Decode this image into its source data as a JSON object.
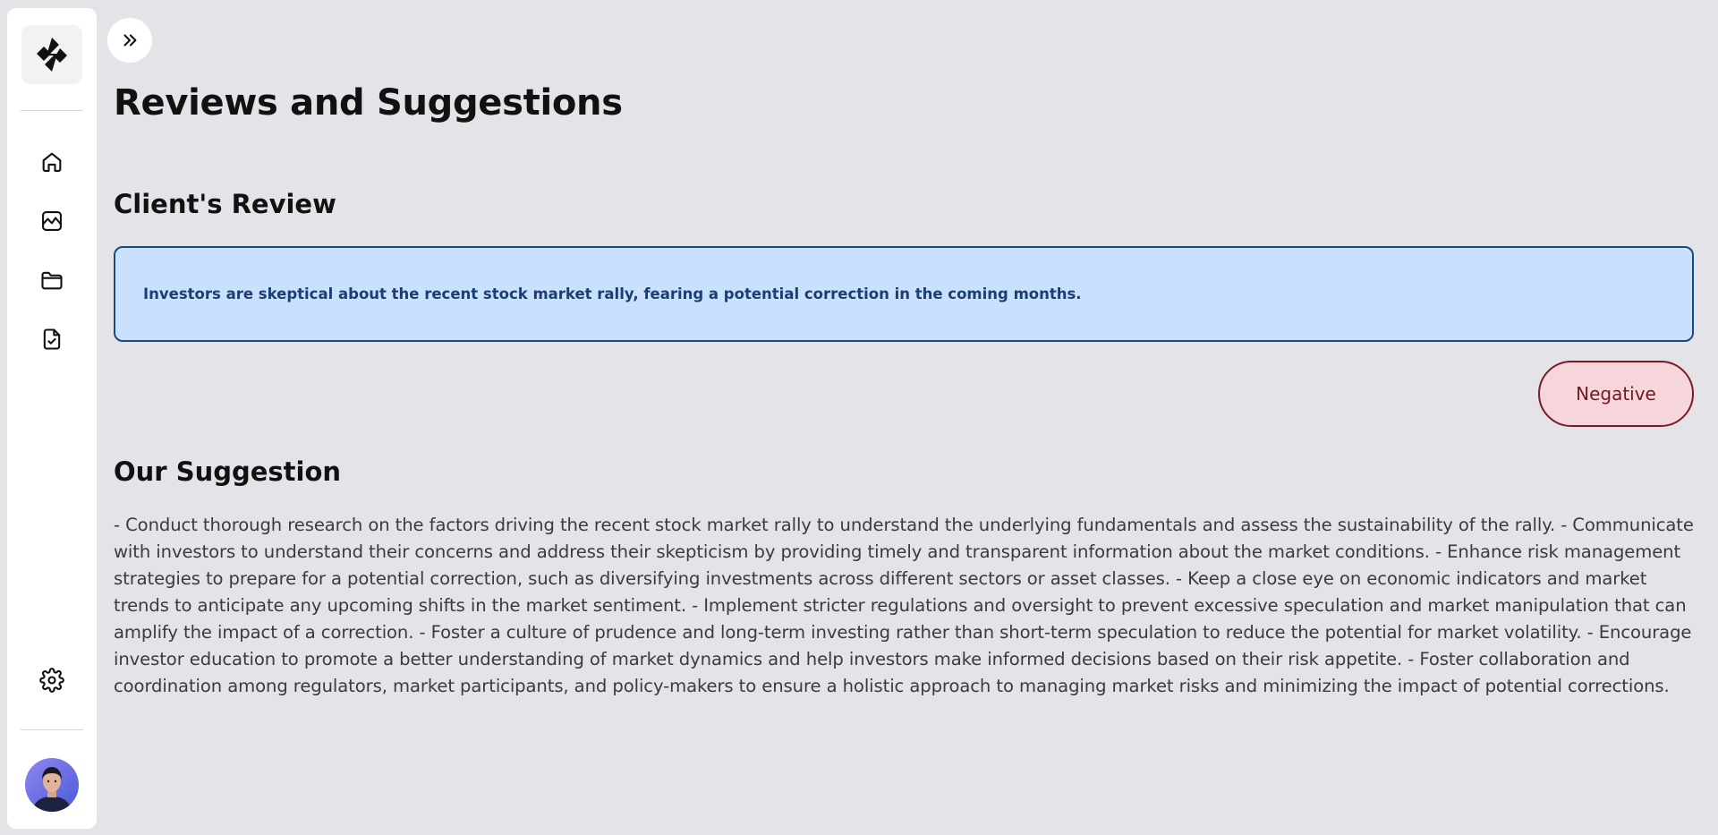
{
  "sidebar": {
    "logo": "logo-icon",
    "nav_items": [
      {
        "name": "home",
        "icon": "home-icon"
      },
      {
        "name": "analytics",
        "icon": "chart-icon"
      },
      {
        "name": "folder",
        "icon": "folder-icon"
      },
      {
        "name": "tasks",
        "icon": "file-check-icon"
      }
    ],
    "settings_icon": "gear-icon",
    "avatar": "user-avatar"
  },
  "header": {
    "expand_icon": "chevrons-right-icon",
    "title": "Reviews and Suggestions"
  },
  "review": {
    "heading": "Client's Review",
    "text": "Investors are skeptical about the recent stock market rally, fearing a potential correction in the coming months.",
    "sentiment": "Negative"
  },
  "suggestion": {
    "heading": "Our Suggestion",
    "text": "- Conduct thorough research on the factors driving the recent stock market rally to understand the underlying fundamentals and assess the sustainability of the rally. - Communicate with investors to understand their concerns and address their skepticism by providing timely and transparent information about the market conditions. - Enhance risk management strategies to prepare for a potential correction, such as diversifying investments across different sectors or asset classes. - Keep a close eye on economic indicators and market trends to anticipate any upcoming shifts in the market sentiment. - Implement stricter regulations and oversight to prevent excessive speculation and market manipulation that can amplify the impact of a correction. - Foster a culture of prudence and long-term investing rather than short-term speculation to reduce the potential for market volatility. - Encourage investor education to promote a better understanding of market dynamics and help investors make informed decisions based on their risk appetite. - Foster collaboration and coordination among regulators, market participants, and policy-makers to ensure a holistic approach to managing market risks and minimizing the impact of potential corrections."
  },
  "colors": {
    "background": "#e4e3e8",
    "review_bg": "#c9e1fc",
    "review_border": "#1a4a82",
    "negative_bg": "#f7d6db",
    "negative_border": "#7a1b26"
  }
}
